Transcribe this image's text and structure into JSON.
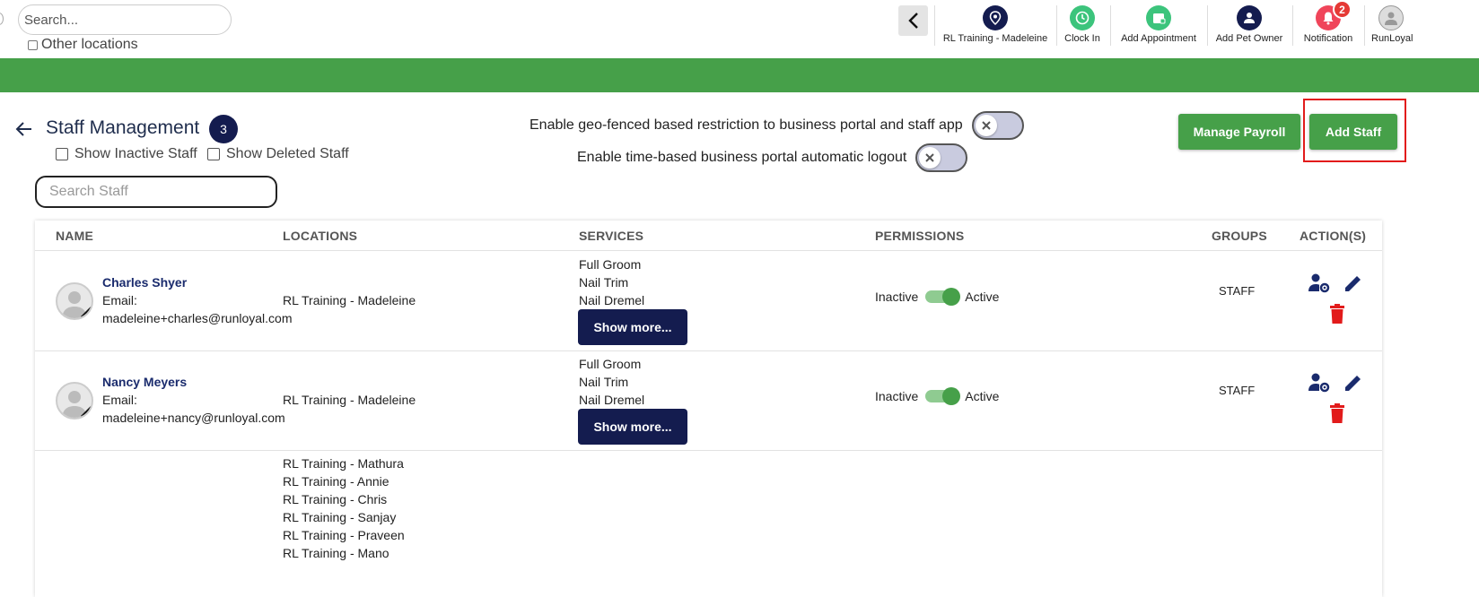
{
  "topbar": {
    "search_placeholder": "Search...",
    "other_locations_label": "Other locations",
    "nav_items": [
      {
        "label": "RL Training - Madeleine",
        "icon": "location-pin-icon",
        "color": "#141c4f"
      },
      {
        "label": "Clock In",
        "icon": "clock-icon",
        "color": "#3cc47c"
      },
      {
        "label": "Add Appointment",
        "icon": "calendar-add-icon",
        "color": "#3cc47c"
      },
      {
        "label": "Add Pet Owner",
        "icon": "add-user-icon",
        "color": "#141c4f"
      },
      {
        "label": "Notification",
        "icon": "bell-icon",
        "color": "#f0455a",
        "badge": "2"
      },
      {
        "label": "RunLoyal",
        "icon": "avatar-icon",
        "color": "#cccccc"
      }
    ]
  },
  "page": {
    "title": "Staff Management",
    "count": "3",
    "show_inactive": "Show Inactive Staff",
    "show_deleted": "Show Deleted Staff",
    "geo_toggle_label": "Enable geo-fenced based restriction to business portal and staff app",
    "logout_toggle_label": "Enable time-based business portal automatic logout",
    "manage_payroll": "Manage Payroll",
    "add_staff": "Add Staff",
    "search_staff_placeholder": "Search Staff"
  },
  "table": {
    "headers": [
      "NAME",
      "LOCATIONS",
      "SERVICES",
      "PERMISSIONS",
      "GROUPS",
      "ACTION(S)"
    ],
    "rows": [
      {
        "name": "Charles Shyer",
        "email_label": "Email:",
        "email": "madeleine+charles@runloyal.com",
        "locations": [
          "RL Training - Madeleine"
        ],
        "services": [
          "Full Groom",
          "Nail Trim",
          "Nail Dremel"
        ],
        "show_more": "Show more...",
        "inactive": "Inactive",
        "active": "Active",
        "group": "STAFF"
      },
      {
        "name": "Nancy Meyers",
        "email_label": "Email:",
        "email": "madeleine+nancy@runloyal.com",
        "locations": [
          "RL Training - Madeleine"
        ],
        "services": [
          "Full Groom",
          "Nail Trim",
          "Nail Dremel"
        ],
        "show_more": "Show more...",
        "inactive": "Inactive",
        "active": "Active",
        "group": "STAFF"
      },
      {
        "locations": [
          "RL Training - Mathura",
          "RL Training - Annie",
          "RL Training - Chris",
          "RL Training - Sanjay",
          "RL Training - Praveen",
          "RL Training - Mano"
        ]
      }
    ]
  },
  "colors": {
    "brand_green": "#46a049",
    "navy": "#141c4f",
    "delete_red": "#e21b1b",
    "highlight_red": "#e21b1b"
  }
}
